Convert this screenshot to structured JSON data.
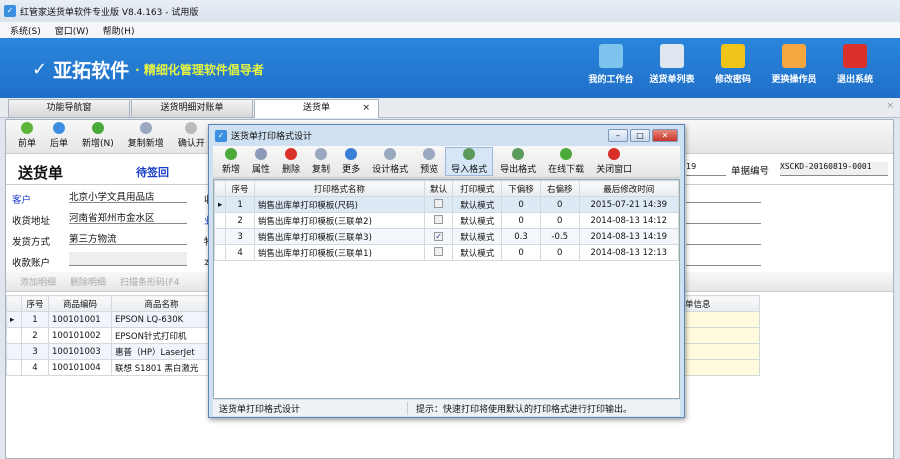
{
  "window": {
    "title": "红管家送货单软件专业版 V8.4.163 - 试用版"
  },
  "menu": [
    "系统(S)",
    "窗口(W)",
    "帮助(H)"
  ],
  "banner": {
    "brand": "亚拓软件",
    "slogan": "· 精细化管理软件倡导者",
    "buttons": [
      {
        "label": "我的工作台",
        "icon": "monitor-icon",
        "color": "#7ec3ee"
      },
      {
        "label": "送货单列表",
        "icon": "list-icon",
        "color": "#dfe6f0"
      },
      {
        "label": "修改密码",
        "icon": "lock-icon",
        "color": "#f0c419"
      },
      {
        "label": "更换操作员",
        "icon": "user-icon",
        "color": "#f4a640"
      },
      {
        "label": "退出系统",
        "icon": "power-icon",
        "color": "#d9302a"
      }
    ]
  },
  "tabs": [
    {
      "label": "功能导航窗"
    },
    {
      "label": "送货明细对账单"
    },
    {
      "label": "送货单",
      "active": true
    }
  ],
  "toolbar": [
    {
      "label": "前单",
      "color": "#5cb43a"
    },
    {
      "label": "后单",
      "color": "#3c8fe0"
    },
    {
      "label": "新增(N)",
      "color": "#4caa3a"
    },
    {
      "label": "复制新增",
      "color": "#9aa8c0"
    },
    {
      "label": "确认开",
      "color": "#bbbbbb"
    }
  ],
  "form": {
    "title": "送货单",
    "status": "待签回",
    "doc_no_label": "单据编号",
    "doc_no": "XSCKD-20160819-0001",
    "date_partial": "19",
    "fields": [
      {
        "label": "客户",
        "value": "北京小学文具用品店"
      },
      {
        "label": "收货地址",
        "value": "河南省郑州市金水区"
      },
      {
        "label": "发货方式",
        "value": "第三方物流"
      },
      {
        "label": "收款账户",
        "value": ""
      }
    ],
    "side_labels": [
      "收",
      "业",
      "物",
      "本"
    ]
  },
  "detail_toolbar": [
    "添加明细",
    "删除明细",
    "扫描条形码(F4"
  ],
  "grid": {
    "headers": [
      "序号",
      "商品编码",
      "商品名称"
    ],
    "extra_header": "单信息",
    "rows": [
      [
        "1",
        "100101001",
        "EPSON LQ-630K"
      ],
      [
        "2",
        "100101002",
        "EPSON针式打印机"
      ],
      [
        "3",
        "100101003",
        "惠普（HP）LaserJet"
      ],
      [
        "4",
        "100101004",
        "联想 S1801 黑白激光"
      ]
    ]
  },
  "dialog": {
    "title": "送货单打印格式设计",
    "toolbar": [
      {
        "label": "新增",
        "color": "#4caa3a"
      },
      {
        "label": "属性",
        "color": "#8a9ab8"
      },
      {
        "label": "删除",
        "color": "#d9302a"
      },
      {
        "label": "复制",
        "color": "#9aa8c0"
      },
      {
        "label": "更多",
        "color": "#3c7fd8"
      },
      {
        "label": "设计格式",
        "color": "#9aa8c0"
      },
      {
        "label": "预览",
        "color": "#9aa8c0"
      },
      {
        "label": "导入格式",
        "color": "#5a9a5a",
        "active": true
      },
      {
        "label": "导出格式",
        "color": "#5a9a5a"
      },
      {
        "label": "在线下载",
        "color": "#4caa3a"
      },
      {
        "label": "关闭窗口",
        "color": "#d9302a"
      }
    ],
    "headers": [
      "序号",
      "打印格式名称",
      "默认",
      "打印模式",
      "下偏移",
      "右偏移",
      "最后修改时间"
    ],
    "rows": [
      {
        "no": "1",
        "name": "销售出库单打印模板(尺码)",
        "default": false,
        "mode": "默认模式",
        "down": "0",
        "right": "0",
        "time": "2015-07-21 14:39"
      },
      {
        "no": "2",
        "name": "销售出库单打印模板(三联单2)",
        "default": false,
        "mode": "默认模式",
        "down": "0",
        "right": "0",
        "time": "2014-08-13 14:12"
      },
      {
        "no": "3",
        "name": "销售出库单打印模板(三联单3)",
        "default": true,
        "mode": "默认模式",
        "down": "0.3",
        "right": "-0.5",
        "time": "2014-08-13 14:19"
      },
      {
        "no": "4",
        "name": "销售出库单打印模板(三联单1)",
        "default": false,
        "mode": "默认模式",
        "down": "0",
        "right": "0",
        "time": "2014-08-13 12:13"
      }
    ],
    "status_left": "送货单打印格式设计",
    "status_right": "提示：快速打印将使用默认的打印格式进行打印输出。"
  }
}
